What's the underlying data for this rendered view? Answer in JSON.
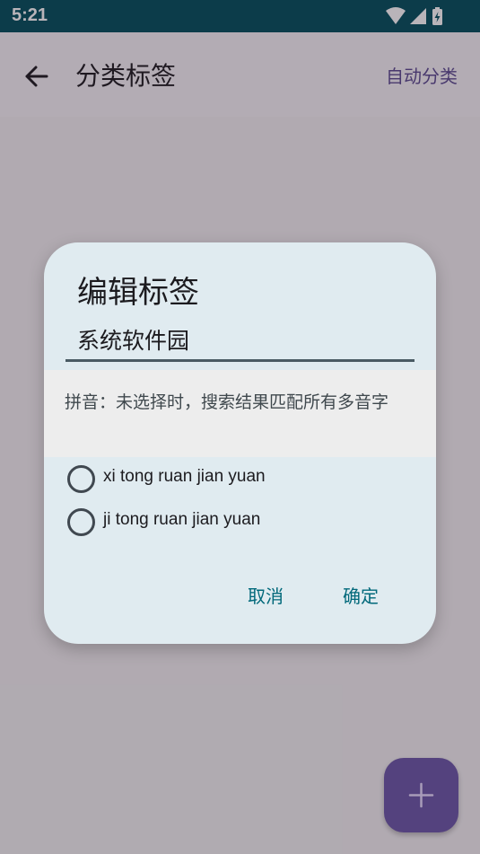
{
  "status_bar": {
    "time": "5:21",
    "icons": [
      "wifi-icon",
      "signal-icon",
      "battery-charging-icon"
    ]
  },
  "app_bar": {
    "title": "分类标签",
    "action_label": "自动分类",
    "back_icon": "arrow-back-icon"
  },
  "fab": {
    "icon": "plus-icon"
  },
  "dialog": {
    "title": "编辑标签",
    "tag_value": "系统软件园",
    "pinyin_hint": "拼音：未选择时，搜索结果匹配所有多音字",
    "options": [
      {
        "label": "xi tong ruan jian yuan",
        "selected": false
      },
      {
        "label": "ji tong ruan jian yuan",
        "selected": false
      }
    ],
    "cancel_label": "取消",
    "confirm_label": "确定"
  },
  "colors": {
    "status_bar": "#004e5c",
    "accent": "#5b4b91",
    "fab": "#6b57a8",
    "dialog_button": "#00687a",
    "dialog_bg": "#e0ebf0"
  }
}
